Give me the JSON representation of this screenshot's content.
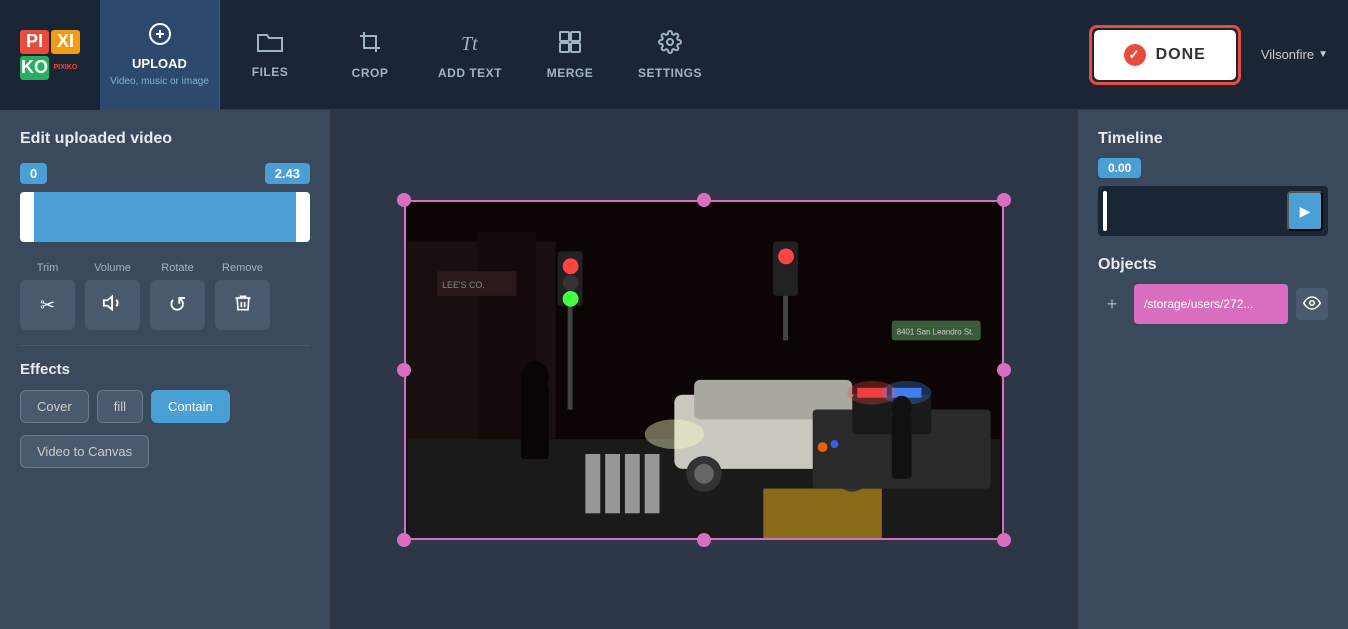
{
  "logo": {
    "cells": [
      {
        "text": "PI",
        "class": "logo-pi"
      },
      {
        "text": "XI",
        "class": "logo-xi"
      },
      {
        "text": "KO",
        "class": "logo-ko"
      },
      {
        "text": "PIXIKO",
        "class": "logo-brand"
      }
    ]
  },
  "nav": {
    "upload": {
      "label": "UPLOAD",
      "sub": "Video, music or image"
    },
    "items": [
      {
        "id": "files",
        "label": "FILES",
        "icon": "folder"
      },
      {
        "id": "crop",
        "label": "CROP",
        "icon": "crop"
      },
      {
        "id": "add-text",
        "label": "ADD TEXT",
        "icon": "text"
      },
      {
        "id": "merge",
        "label": "MERGE",
        "icon": "merge"
      },
      {
        "id": "settings",
        "label": "SETTINGS",
        "icon": "settings"
      }
    ],
    "done_label": "DONE",
    "user": "Vilsonfire"
  },
  "left_panel": {
    "title": "Edit uploaded video",
    "trim": {
      "start": "0",
      "end": "2.43"
    },
    "tools": [
      {
        "id": "trim",
        "label": "Trim",
        "icon": "scissors"
      },
      {
        "id": "volume",
        "label": "Volume",
        "icon": "volume"
      },
      {
        "id": "rotate",
        "label": "Rotate",
        "icon": "rotate"
      },
      {
        "id": "remove",
        "label": "Remove",
        "icon": "trash"
      }
    ],
    "effects_title": "Effects",
    "effects": [
      {
        "id": "cover",
        "label": "Cover",
        "active": false
      },
      {
        "id": "fill",
        "label": "fill",
        "active": false
      },
      {
        "id": "contain",
        "label": "Contain",
        "active": true
      }
    ],
    "video_to_canvas_label": "Video to Canvas"
  },
  "timeline": {
    "title": "Timeline",
    "time": "0.00",
    "play_label": "▶"
  },
  "objects": {
    "title": "Objects",
    "add_icon": "+",
    "item_path": "/storage/users/272...",
    "eye_icon": "👁"
  }
}
